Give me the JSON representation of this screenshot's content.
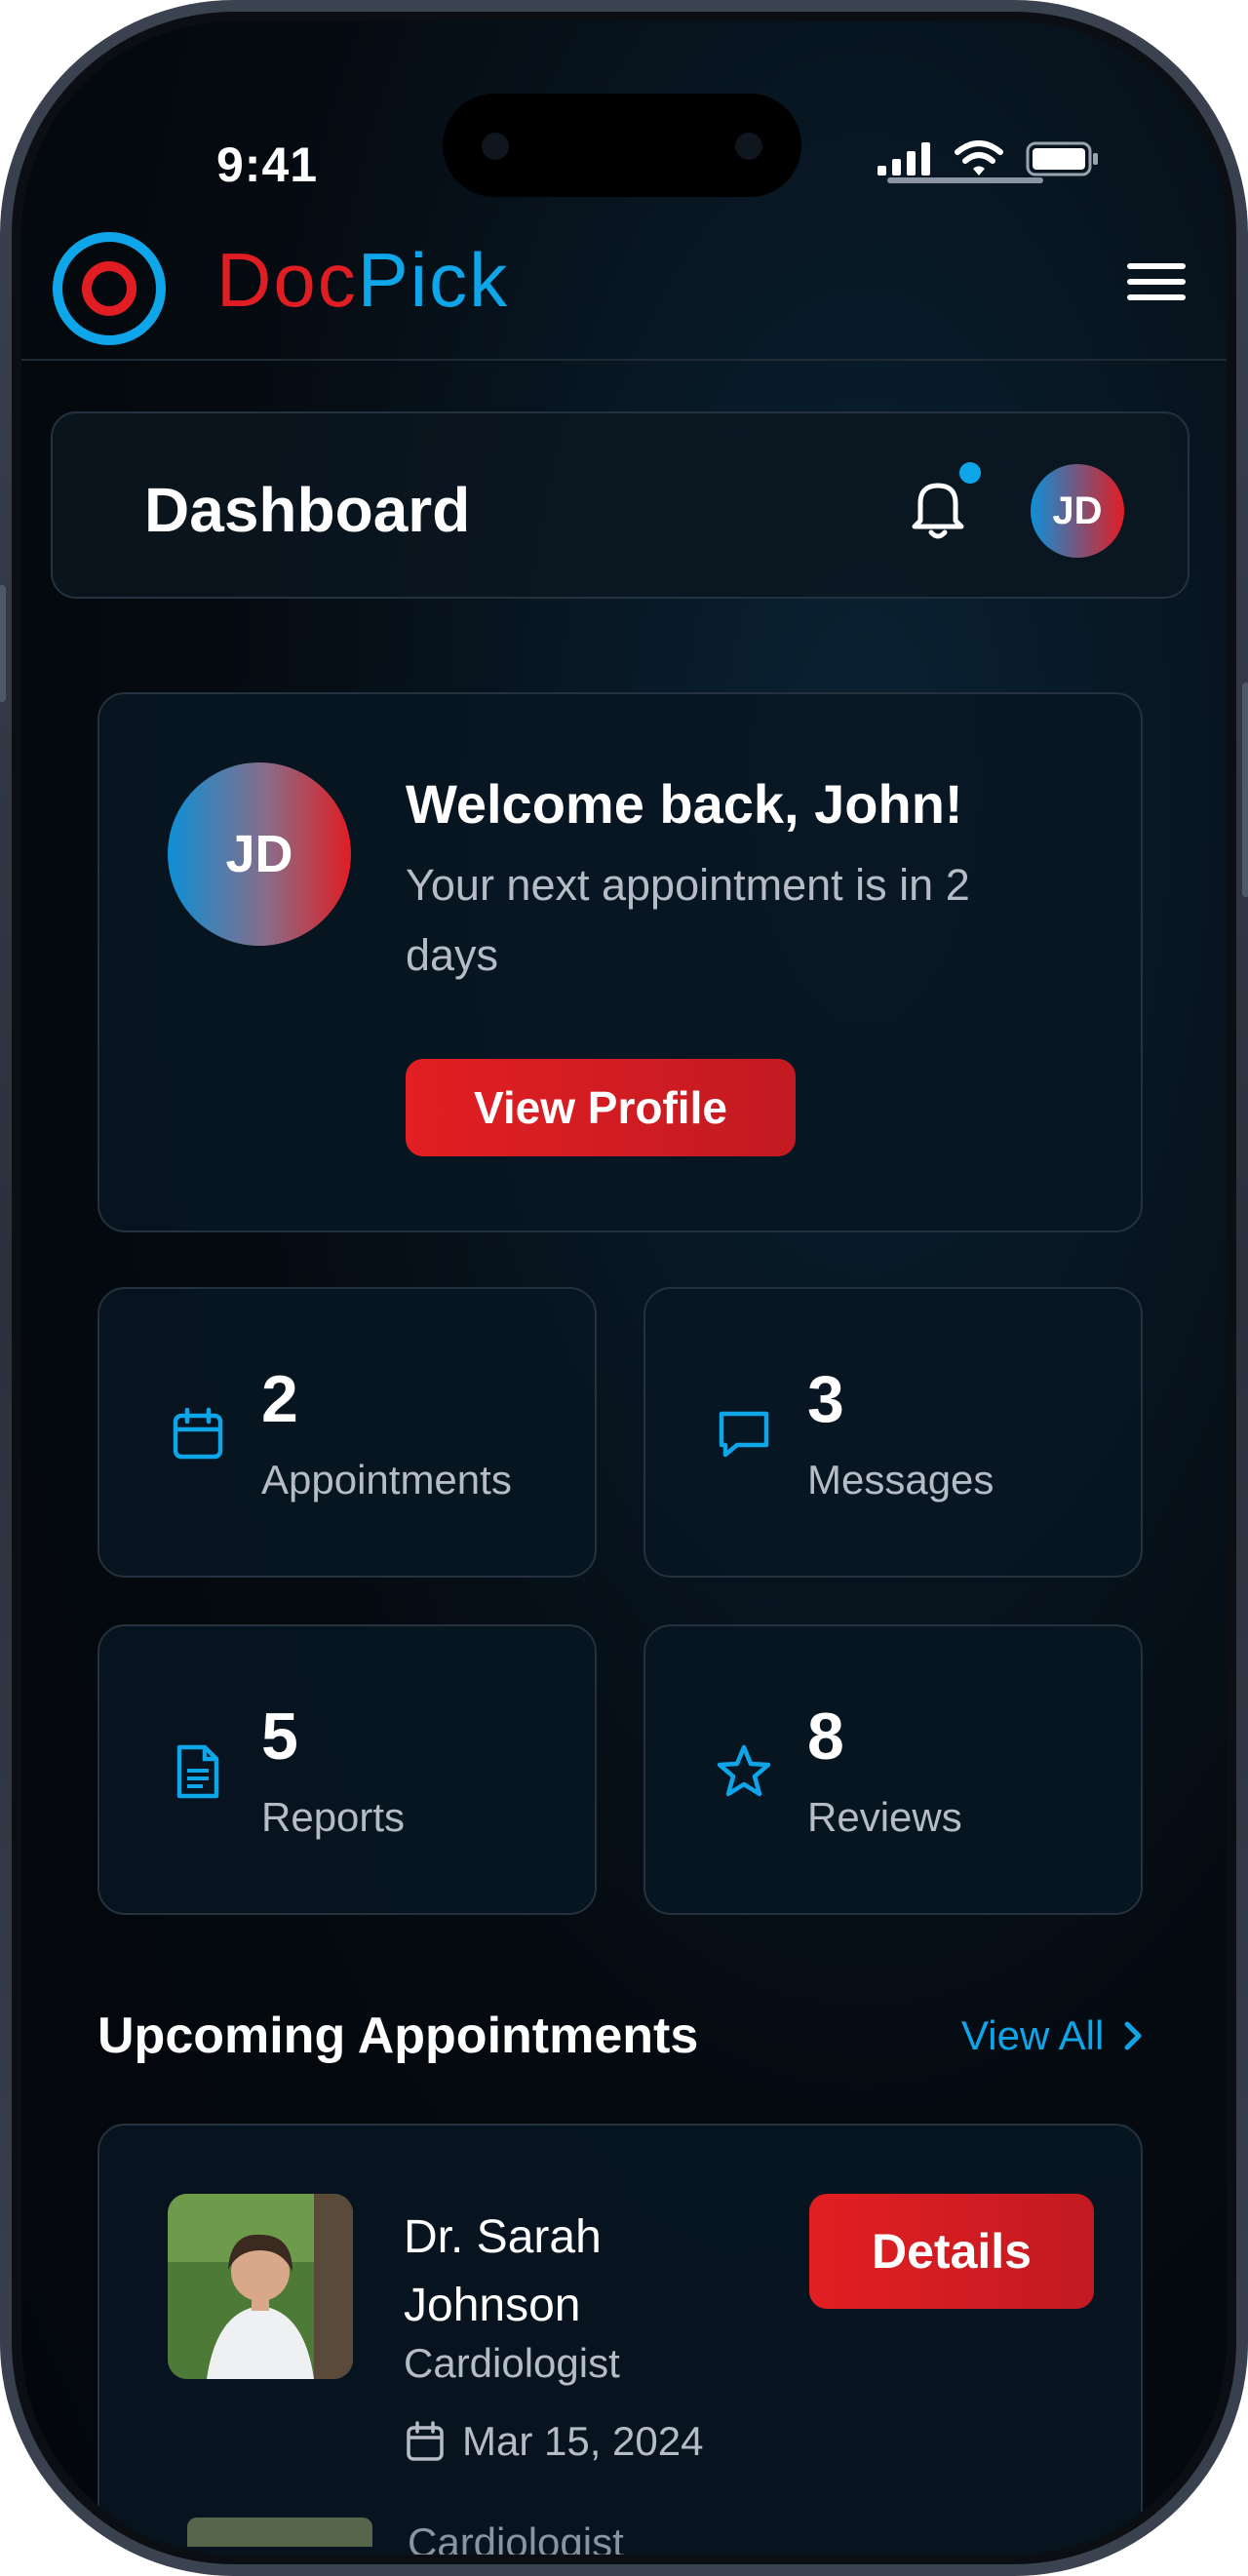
{
  "status_bar": {
    "time": "9:41"
  },
  "header": {
    "logo_part1": "Doc",
    "logo_part2": "Pick"
  },
  "dashboard": {
    "title": "Dashboard",
    "user_initials": "JD"
  },
  "welcome": {
    "initials": "JD",
    "title": "Welcome back, John!",
    "subtitle": "Your next appointment is in 2 days",
    "button": "View Profile"
  },
  "stats": [
    {
      "value": "2",
      "label": "Appointments",
      "icon": "calendar-icon"
    },
    {
      "value": "3",
      "label": "Messages",
      "icon": "message-icon"
    },
    {
      "value": "5",
      "label": "Reports",
      "icon": "document-icon"
    },
    {
      "value": "8",
      "label": "Reviews",
      "icon": "star-icon"
    }
  ],
  "upcoming": {
    "title": "Upcoming Appointments",
    "view_all": "View All",
    "appointments": [
      {
        "doctor": "Dr. Sarah Johnson",
        "specialty": "Cardiologist",
        "date": "Mar 15, 2024",
        "button": "Details"
      }
    ],
    "next_peek_specialty": "Cardiologist"
  },
  "colors": {
    "accent_blue": "#0ea5e9",
    "accent_red": "#e11d24",
    "background": "#03070b"
  }
}
